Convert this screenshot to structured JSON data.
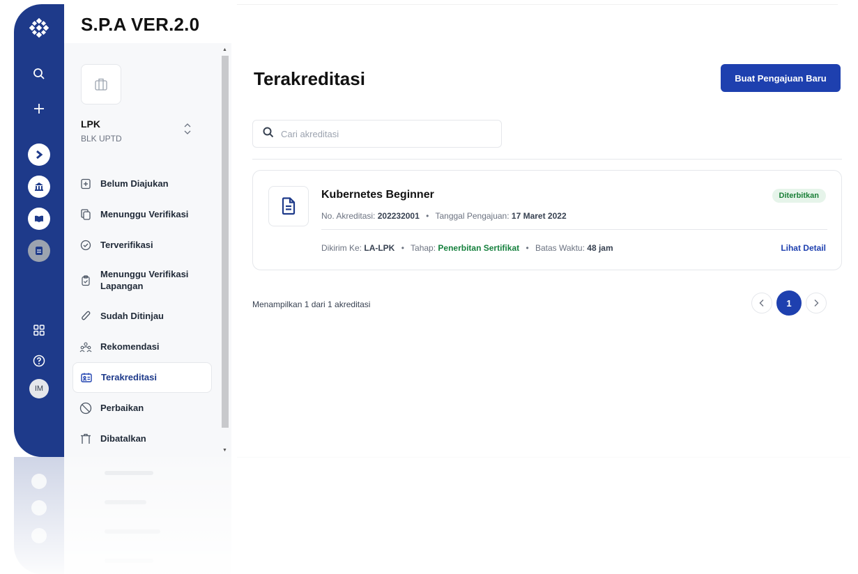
{
  "app": {
    "brand": "S.P.A VER.2.0"
  },
  "rail": {
    "avatar_initials": "IM",
    "icons": [
      "logo-icon",
      "search-icon",
      "plus-icon",
      "arrow-right-icon",
      "bank-icon",
      "book-icon",
      "document-icon",
      "grid-icon",
      "help-icon"
    ]
  },
  "org": {
    "title": "LPK",
    "subtitle": "BLK UPTD"
  },
  "sidebar": {
    "items": [
      {
        "label": "Belum Diajukan",
        "icon": "file-plus-icon"
      },
      {
        "label": "Menunggu Verifikasi",
        "icon": "copy-icon"
      },
      {
        "label": "Terverifikasi",
        "icon": "check-circle-icon"
      },
      {
        "label": "Menunggu Verifikasi Lapangan",
        "icon": "clipboard-check-icon"
      },
      {
        "label": "Sudah Ditinjau",
        "icon": "paperclip-icon"
      },
      {
        "label": "Rekomendasi",
        "icon": "users-icon"
      },
      {
        "label": "Terakreditasi",
        "icon": "id-card-icon",
        "active": true
      },
      {
        "label": "Perbaikan",
        "icon": "ban-icon"
      },
      {
        "label": "Dibatalkan",
        "icon": "trash-icon"
      }
    ]
  },
  "main": {
    "title": "Terakreditasi",
    "new_button": "Buat Pengajuan Baru",
    "search_placeholder": "Cari akreditasi",
    "summary": "Menampilkan 1 dari 1 akreditasi",
    "current_page": "1"
  },
  "card": {
    "title": "Kubernetes Beginner",
    "status": "Diterbitkan",
    "status_color": "#1a7f37",
    "no_label": "No. Akreditasi:",
    "no_value": "202232001",
    "date_label": "Tanggal Pengajuan:",
    "date_value": "17 Maret 2022",
    "sent_label": "Dikirim Ke:",
    "sent_value": "LA-LPK",
    "stage_label": "Tahap:",
    "stage_value": "Penerbitan Sertifikat",
    "deadline_label": "Batas Waktu:",
    "deadline_value": "48 jam",
    "detail_link": "Lihat Detail"
  },
  "colors": {
    "primary": "#1e40af",
    "rail": "#1e3a8a",
    "success": "#15803d"
  }
}
